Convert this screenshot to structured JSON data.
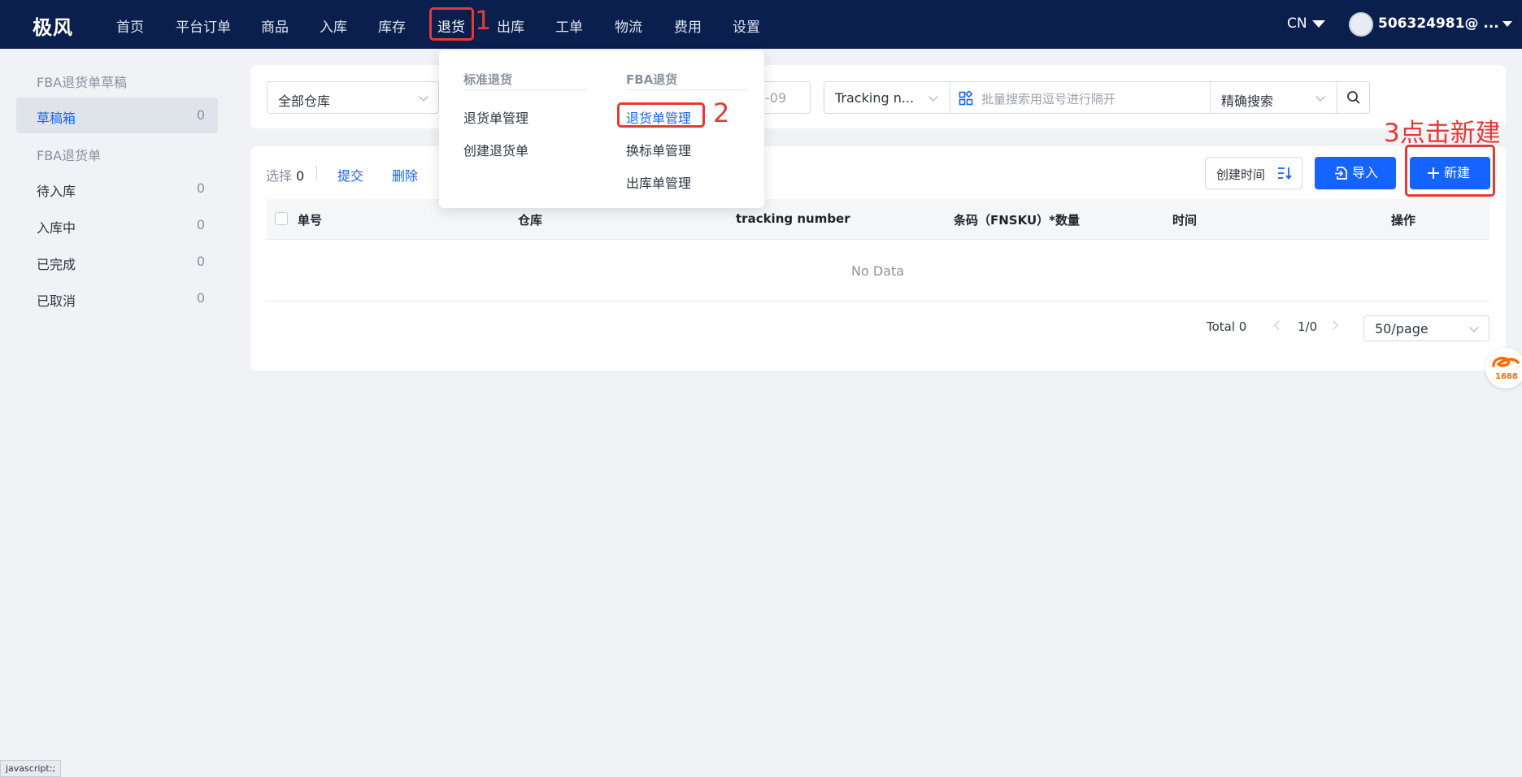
{
  "app": {
    "logo": "极风"
  },
  "nav": {
    "items": [
      "首页",
      "平台订单",
      "商品",
      "入库",
      "库存",
      "退货",
      "出库",
      "工单",
      "物流",
      "费用",
      "设置"
    ],
    "lang": "CN",
    "user": "506324981@ ..."
  },
  "sidebar": {
    "group1": "FBA退货单草稿",
    "drafts": {
      "label": "草稿箱",
      "count": "0"
    },
    "group2": "FBA退货单",
    "items": [
      {
        "label": "待入库",
        "count": "0"
      },
      {
        "label": "入库中",
        "count": "0"
      },
      {
        "label": "已完成",
        "count": "0"
      },
      {
        "label": "已取消",
        "count": "0"
      }
    ]
  },
  "filters": {
    "warehouse": "全部仓库",
    "date_partial": "-09",
    "tracking_select": "Tracking n...",
    "search_placeholder": "批量搜索用逗号进行隔开",
    "match_mode": "精确搜索"
  },
  "toolbar": {
    "select_label": "选择",
    "select_count": "0",
    "submit": "提交",
    "delete": "删除",
    "sort_label": "创建时间",
    "import": "导入",
    "create": "新建"
  },
  "table": {
    "columns": [
      "单号",
      "仓库",
      "tracking number",
      "条码（FNSKU）*数量",
      "时间",
      "操作"
    ],
    "empty_text": "No Data"
  },
  "pagination": {
    "total": "Total 0",
    "page": "1/0",
    "page_size": "50/page"
  },
  "dropdown": {
    "col1_title": "标准退货",
    "col1_items": [
      "退货单管理",
      "创建退货单"
    ],
    "col2_title": "FBA退货",
    "col2_items": [
      "退货单管理",
      "换标单管理",
      "出库单管理"
    ]
  },
  "annotations": {
    "step1": "1",
    "step2": "2",
    "step3": "3点击新建"
  },
  "floating": {
    "logo_text": "1688"
  },
  "status_bar": "javascript:;",
  "colors": {
    "nav_bg": "#0a1f4d",
    "primary": "#1664ff",
    "annotation": "#e53935"
  }
}
